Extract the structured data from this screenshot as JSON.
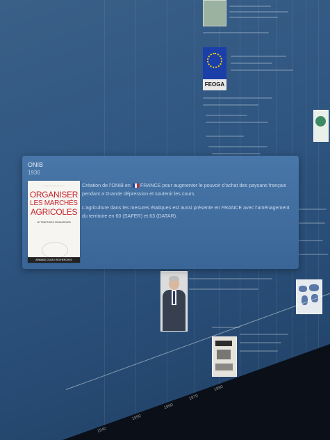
{
  "popup": {
    "title": "ONIB",
    "year": "1936",
    "paragraph1_before_flag": "Création de l’ONIB en",
    "paragraph1_after_flag": "FRANCE pour augmenter le pouvoir d’achat des paysans français pendant a Grande dépression et soutenir les cours.",
    "paragraph2": "L’agriculture dans les mesures étatiques est aussi présente en FRANCE avec l’aménagement du territoire en 60 (SAFER) et 63 (DATAR).",
    "book": {
      "title_lines": [
        "ORGANISER",
        "LES MARCHÉS",
        "AGRICOLES"
      ],
      "subtitle": "LE TEMPS DES FONDATEURS",
      "publisher": "ARMAND COLIN / RECHERCHES"
    }
  },
  "background": {
    "eu_flag_label": "FEOGA"
  },
  "axis": {
    "tick_labels": [
      "1940",
      "1950",
      "1960",
      "1970",
      "1980"
    ]
  },
  "colors": {
    "background": "#2b4f78",
    "card": "#4a78aa",
    "floor": "#0a0f18"
  }
}
